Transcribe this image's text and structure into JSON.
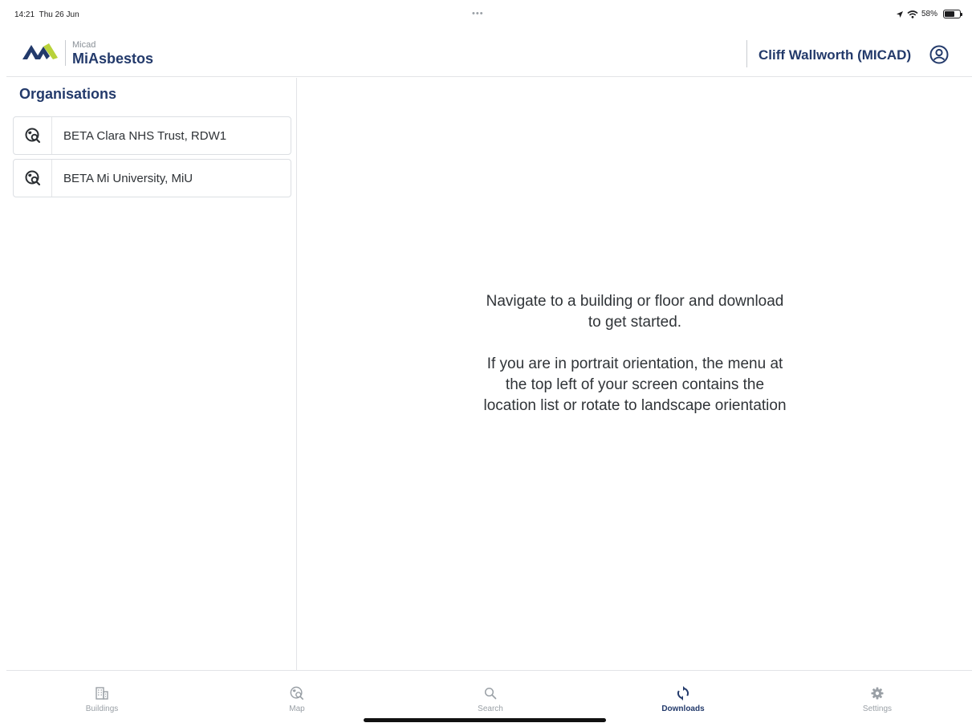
{
  "status_bar": {
    "time": "14:21",
    "date": "Thu 26 Jun",
    "battery": "58%"
  },
  "header": {
    "brand_small": "Micad",
    "brand_name": "MiAsbestos",
    "user_name": "Cliff Wallworth (MICAD)"
  },
  "sidebar": {
    "title": "Organisations",
    "items": [
      {
        "label": "BETA Clara NHS Trust, RDW1",
        "icon": "map-search-icon"
      },
      {
        "label": "BETA Mi University, MiU",
        "icon": "map-search-icon"
      }
    ]
  },
  "main": {
    "message_1": "Navigate to a building or floor and download to get started.",
    "message_2": "If you are in portrait orientation, the menu at the top left of your screen contains the location list or rotate to landscape orientation"
  },
  "tabs": [
    {
      "label": "Buildings",
      "icon": "buildings-icon",
      "active": false
    },
    {
      "label": "Map",
      "icon": "map-icon",
      "active": false
    },
    {
      "label": "Search",
      "icon": "search-icon",
      "active": false
    },
    {
      "label": "Downloads",
      "icon": "downloads-icon",
      "active": true
    },
    {
      "label": "Settings",
      "icon": "gear-icon",
      "active": false
    }
  ],
  "colors": {
    "brand_navy": "#233a6b",
    "logo_green": "#b9d23a",
    "tab_inactive": "#9aa0a6"
  }
}
